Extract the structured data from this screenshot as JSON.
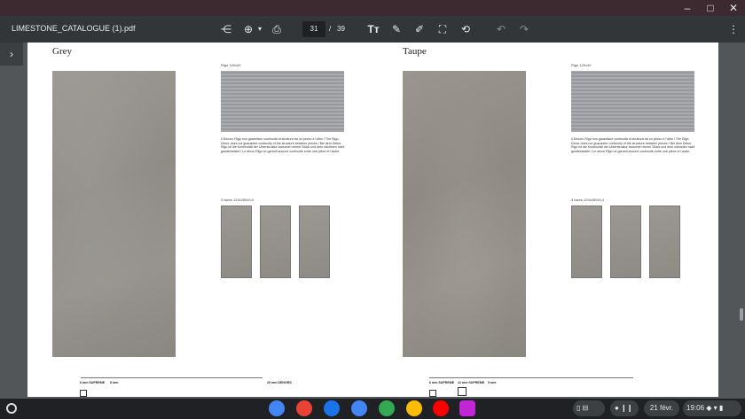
{
  "window": {
    "controls": {
      "minimize": "–",
      "maximize": "□",
      "close": "✕"
    }
  },
  "toolbar": {
    "doc_title": "LIMESTONE_CATALOGUE (1).pdf",
    "page_current": "31",
    "page_separator": "/",
    "page_total": "39",
    "icons": [
      "share-icon",
      "zoom-icon",
      "chevron-down-icon",
      "print-icon",
      "text-icon",
      "highlighter-icon",
      "pen-icon",
      "crop-icon",
      "ai-icon",
      "undo-icon",
      "redo-icon",
      "more-icon"
    ]
  },
  "document": {
    "left": {
      "title": "Grey",
      "rigo_label": "Rigo 120x40",
      "description": "Il Decoro Rigo non garantisce continuità di struttura tra un pezzo e l'altro / The Rigo Decor does not guarantee continuity of the structure between pieces / Bei dem Dekor Rigo ist die Kontinuität der Unterstruktur zwischen einem Stück und dem nächsten nicht gewährleistet / Le décor Rigo ne garanti aucune continuité entre une pièce et l'autre.",
      "faces_label": "3 faces 120x280x0,4",
      "spec_a": "6 mm SUPREME",
      "spec_b": "9 mm",
      "spec_c": "20 mm DEHORS"
    },
    "right": {
      "title": "Taupe",
      "rigo_label": "Rigo 120x40",
      "description": "Il Decoro Rigo non garantisce continuità di struttura tra un pezzo e l'altro / The Rigo Decor does not guarantee continuity of the structure between pieces / Bei dem Dekor Rigo ist die Kontinuität der Unterstruktur zwischen einem Stück und dem nächsten nicht gewährleistet / Le décor Rigo ne garanti aucune continuité entre une pièce et l'autre.",
      "faces_label": "3 faces 120x280x0,4",
      "spec_a": "6 mm SUPREME",
      "spec_b": "12 mm SUPREME",
      "spec_c": "9 mm"
    }
  },
  "shelf": {
    "date": "21 févr.",
    "time": "19:06",
    "apps": [
      "chrome",
      "gmail",
      "calendar",
      "files",
      "photos",
      "play-store",
      "youtube",
      "app"
    ],
    "app_colors": [
      "#4285f4",
      "#ea4335",
      "#1a73e8",
      "#4285f4",
      "#34a853",
      "#fbbc04",
      "#ff0000",
      "#c026d3"
    ]
  }
}
